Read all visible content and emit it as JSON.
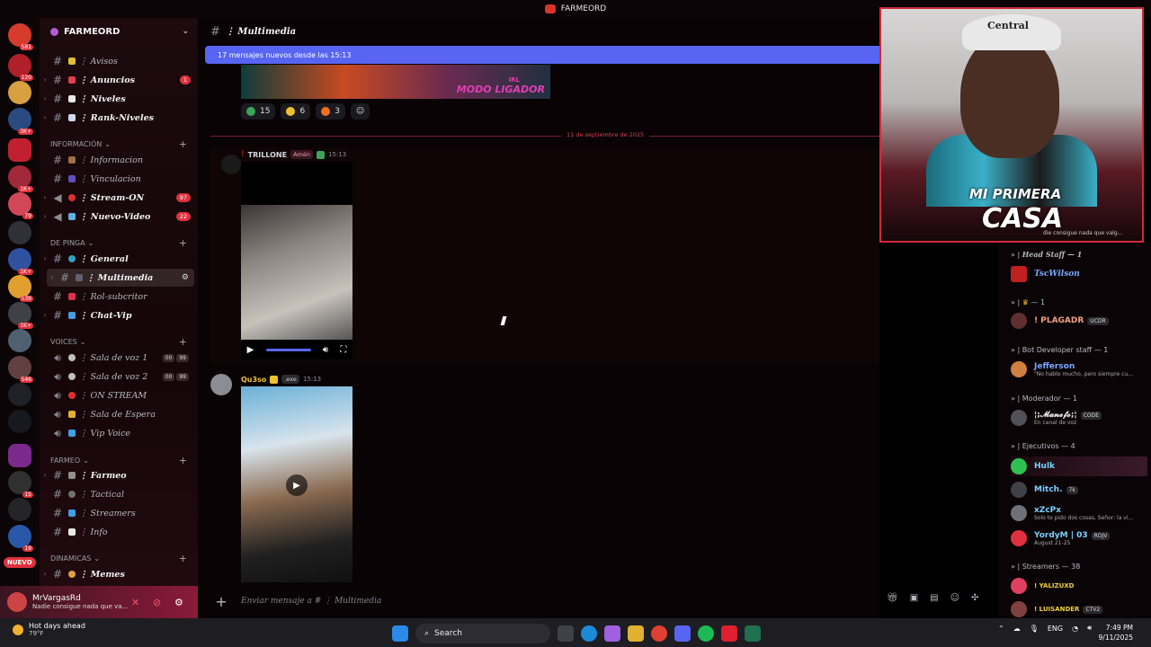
{
  "window": {
    "title": "FARMEORD"
  },
  "rail": {
    "nuevo_label": "NUEVO",
    "badges": [
      "581",
      "120",
      "3K+",
      "1K+",
      "79",
      "1K+",
      "539",
      "1K+",
      "546",
      "15",
      "19"
    ]
  },
  "guild": {
    "name": "FARMEORD"
  },
  "categories": {
    "informacion": "INFORMACIÓN",
    "de_pinga": "DE PINGA",
    "voices": "VOICES",
    "farmeo": "FARMEO",
    "dinamicas": "DINAMICAS"
  },
  "channels": {
    "avisos": "⋮ Avisos",
    "anuncios": "⋮ Anuncios",
    "anuncios_count": "1",
    "niveles": "⋮ Niveles",
    "rank_niveles": "⋮ Rank-Niveles",
    "informacion": "⋮ Informacion",
    "vinculacion": "⋮ Vinculacion",
    "stream_on": "⋮ Stream-ON",
    "stream_on_count": "97",
    "nuevo_video": "⋮ Nuevo-Video",
    "nuevo_video_count": "22",
    "general": "⋮ General",
    "multimedia": "⋮ Multimedia",
    "rol_subcritor": "⋮ Rol-subcritor",
    "chat_vip": "⋮ Chat-Vip",
    "sala_voz_1": "⋮ Sala de voz 1",
    "sala_voz_2": "⋮ Sala de voz 2",
    "voz_count_a": "00",
    "voz_count_b": "99",
    "on_stream": "⋮ ON STREAM",
    "sala_espera": "⋮ Sala de Espera",
    "vip_voice": "⋮ Vip Voice",
    "farmeo": "⋮ Farmeo",
    "tactical": "⋮ Tactical",
    "streamers": "⋮ Streamers",
    "info": "⋮ Info",
    "memes": "⋮ Memes"
  },
  "user": {
    "name": "MrVargasRd",
    "status": "Nadie consigue nada que va..."
  },
  "main": {
    "channel_title": "⋮ Multimedia",
    "new_messages": "17 mensajes nuevos desde las 15:13",
    "banner_irl": "IRL",
    "banner_text": "MODO LIGADOR",
    "reactions": [
      {
        "emoji": "check",
        "count": "15"
      },
      {
        "emoji": "laugh",
        "count": "6"
      },
      {
        "emoji": "fire",
        "count": "3"
      }
    ],
    "date_divider": "11 de septiembre de 2025",
    "msg1": {
      "author": "TRILLONE",
      "tag": "Amén",
      "time": "15:13"
    },
    "msg2": {
      "author": "Qu3so",
      "tag": ".exe",
      "time": "15:13"
    },
    "composer_placeholder": "Enviar mensaje a # ⋮ Multimedia"
  },
  "camera": {
    "cap_text": "Central",
    "logo_line1": "MI PRIMERA",
    "logo_line2": "CASA",
    "ticker": "die consigue nada que valg..."
  },
  "members": {
    "head_staff": "Head Staff — 1",
    "crown": "— 1",
    "bot_dev": "Bot Developer staff — 1",
    "moderador": "Moderador — 1",
    "ejecutivos": "Ejecutivos — 4",
    "streamers": "Streamers — 38",
    "list": [
      {
        "name": "TscWilson",
        "sub": "",
        "tag": "",
        "color": "#7aa8ff"
      },
      {
        "name": "! PLAGADR",
        "sub": "",
        "tag": "UCDR",
        "color": "#f0a080"
      },
      {
        "name": "Jefferson",
        "sub": "\"No hablo mucho, pero siempre cu...",
        "tag": "",
        "color": "#7aa8ff"
      },
      {
        "name": "¦;𝓜𝓪𝓷𝓮𝓯𝓸;¦",
        "sub": "En canal de voz",
        "tag": "CODE",
        "color": "#e4e4e4"
      },
      {
        "name": "Hulk",
        "sub": "",
        "tag": "",
        "color": "#7ad0ff"
      },
      {
        "name": "Mitch.",
        "sub": "",
        "tag": "7k",
        "color": "#7ad0ff"
      },
      {
        "name": "xZcPx",
        "sub": "Solo te pido dos cosas, Señor: la vi...",
        "tag": "",
        "color": "#7ad0ff"
      },
      {
        "name": "YordyM | 03",
        "sub": "August 21-25",
        "tag": "RDJV",
        "color": "#7ad0ff"
      },
      {
        "name": "! YALIZUXD",
        "sub": "",
        "tag": "",
        "color": "#f0d040"
      },
      {
        "name": "! LUISANDER",
        "sub": "",
        "tag": "CTV2",
        "color": "#f0d040"
      }
    ]
  },
  "taskbar": {
    "weather_title": "Hot days ahead",
    "weather_temp": "79°F",
    "search": "Search",
    "lang": "ENG",
    "time": "7:49 PM",
    "date": "9/11/2025"
  },
  "colors": {
    "accent": "#5865f2",
    "danger": "#e0313c",
    "bg": "#090305"
  }
}
